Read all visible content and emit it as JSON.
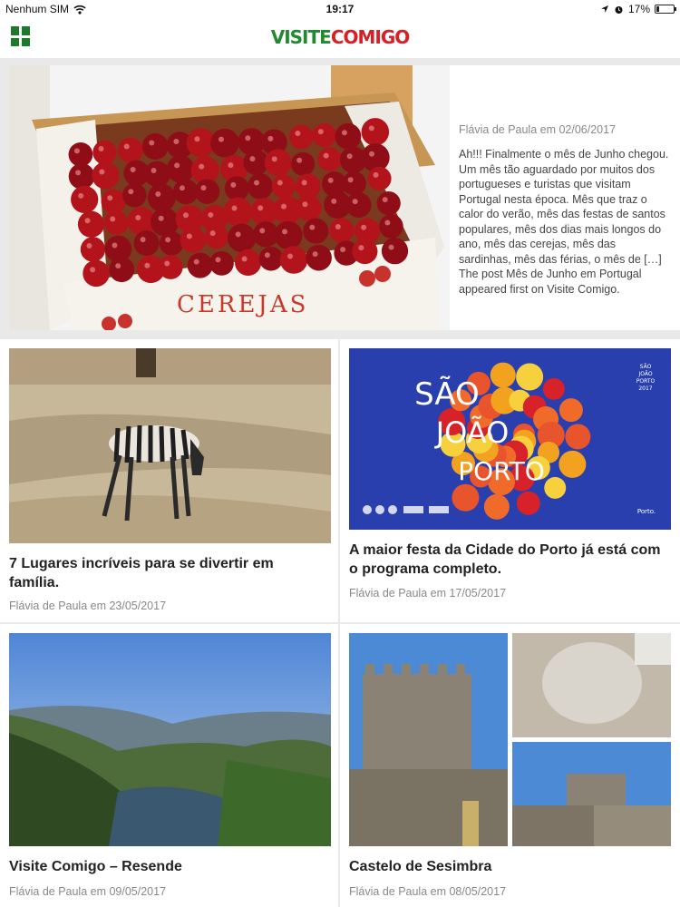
{
  "status_bar": {
    "carrier": "Nenhum SIM",
    "time": "19:17",
    "battery_text": "17%",
    "battery_level": 0.17,
    "icons": [
      "wifi-icon",
      "location-icon",
      "alarm-icon",
      "battery-icon"
    ]
  },
  "header": {
    "logo_part1": "VISITE",
    "logo_part2": "COMIGO",
    "menu_icon": "grid-menu-icon",
    "brand_green": "#1f8a2e",
    "brand_red": "#d81f26"
  },
  "featured": {
    "image_label": "CEREJAS",
    "meta": "Flávia de Paula em 02/06/2017",
    "excerpt": "Ah!!! Finalmente o mês de Junho chegou.   Um mês tão aguardado por muitos dos portugueses e turistas que visitam Portugal nesta época. Mês que traz o calor do verão, mês das festas de santos populares, mês dos dias mais longos do ano, mês das cerejas, mês das sardinhas, mês das férias, o mês de […]",
    "footer": "The post Mês de Junho em Portugal appeared first on Visite Comigo."
  },
  "cards": [
    {
      "title": "7 Lugares incríveis para se divertir em família.",
      "meta": "Flávia de Paula em 23/05/2017"
    },
    {
      "title": "A maior festa da Cidade do Porto já está com o programa completo.",
      "meta": "Flávia de Paula em 17/05/2017",
      "poster_lines": [
        "SÃO",
        "JOÃO",
        "PORTO"
      ],
      "poster_corner": [
        "SÃO",
        "JOÃO",
        "PORTO",
        "2017"
      ],
      "poster_tag": "Porto."
    },
    {
      "title": "Visite Comigo – Resende",
      "meta": "Flávia de Paula em 09/05/2017"
    },
    {
      "title": "Castelo de Sesimbra",
      "meta": "Flávia de Paula em 08/05/2017"
    }
  ]
}
